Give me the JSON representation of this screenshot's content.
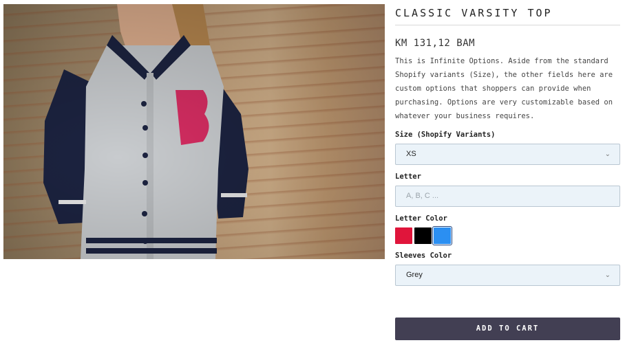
{
  "product": {
    "title": "CLASSIC VARSITY TOP",
    "price": "KM 131,12 BAM",
    "description": "This is Infinite Options. Aside from the standard Shopify variants (Size), the other fields here are custom options that shoppers can provide when purchasing. Options are very customizable based on whatever your business requires."
  },
  "options": {
    "size_label": "Size (Shopify Variants)",
    "size_value": "XS",
    "letter_label": "Letter",
    "letter_placeholder": "A, B, C ...",
    "letter_color_label": "Letter Color",
    "letter_colors": [
      "#e0153b",
      "#000000",
      "#2b8ff2"
    ],
    "sleeves_label": "Sleeves Color",
    "sleeves_value": "Grey"
  },
  "cart": {
    "label": "ADD TO CART"
  },
  "icons": {
    "chevron": "chevron-down-icon"
  }
}
